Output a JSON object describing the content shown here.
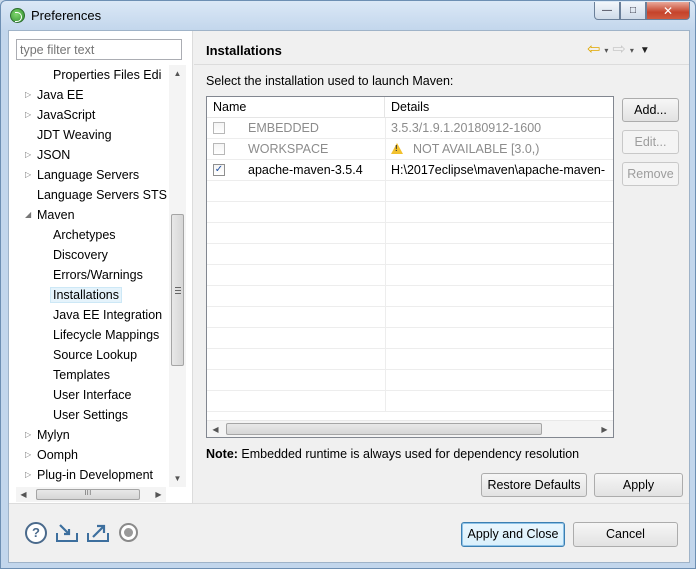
{
  "window": {
    "title": "Preferences",
    "buttons": {
      "minimize": "—",
      "maximize": "□",
      "close": "✕"
    }
  },
  "sidebar": {
    "filter_placeholder": "type filter text",
    "items": [
      {
        "label": "Properties Files Edi",
        "level": 2,
        "twisty": ""
      },
      {
        "label": "Java EE",
        "level": 1,
        "twisty": "▷"
      },
      {
        "label": "JavaScript",
        "level": 1,
        "twisty": "▷"
      },
      {
        "label": "JDT Weaving",
        "level": 1,
        "twisty": ""
      },
      {
        "label": "JSON",
        "level": 1,
        "twisty": "▷"
      },
      {
        "label": "Language Servers",
        "level": 1,
        "twisty": "▷"
      },
      {
        "label": "Language Servers STS",
        "level": 1,
        "twisty": ""
      },
      {
        "label": "Maven",
        "level": 1,
        "twisty": "◢"
      },
      {
        "label": "Archetypes",
        "level": 2,
        "twisty": ""
      },
      {
        "label": "Discovery",
        "level": 2,
        "twisty": ""
      },
      {
        "label": "Errors/Warnings",
        "level": 2,
        "twisty": ""
      },
      {
        "label": "Installations",
        "level": 2,
        "twisty": "",
        "selected": true
      },
      {
        "label": "Java EE Integration",
        "level": 2,
        "twisty": ""
      },
      {
        "label": "Lifecycle Mappings",
        "level": 2,
        "twisty": ""
      },
      {
        "label": "Source Lookup",
        "level": 2,
        "twisty": ""
      },
      {
        "label": "Templates",
        "level": 2,
        "twisty": ""
      },
      {
        "label": "User Interface",
        "level": 2,
        "twisty": ""
      },
      {
        "label": "User Settings",
        "level": 2,
        "twisty": ""
      },
      {
        "label": "Mylyn",
        "level": 1,
        "twisty": "▷"
      },
      {
        "label": "Oomph",
        "level": 1,
        "twisty": "▷"
      },
      {
        "label": "Plug-in Development",
        "level": 1,
        "twisty": "▷"
      }
    ],
    "scroll_up": "▲",
    "scroll_down": "▼",
    "scroll_left": "◀",
    "scroll_right": "▶",
    "hscroll_grip": "III"
  },
  "main": {
    "title": "Installations",
    "nav": {
      "back": "⇦",
      "forward": "⇨",
      "dropdown": "▾",
      "menu": "▼"
    },
    "instruction": "Select the installation used to launch Maven:",
    "table": {
      "columns": [
        "Name",
        "Details"
      ],
      "rows": [
        {
          "checked": false,
          "enabled": false,
          "name": "EMBEDDED",
          "details": "3.5.3/1.9.1.20180912-1600",
          "warning": false
        },
        {
          "checked": false,
          "enabled": false,
          "name": "WORKSPACE",
          "details": "NOT AVAILABLE [3.0,)",
          "warning": true
        },
        {
          "checked": true,
          "enabled": true,
          "name": "apache-maven-3.5.4",
          "details": "H:\\2017eclipse\\maven\\apache-maven-",
          "warning": false
        }
      ],
      "check_mark": "✓"
    },
    "buttons": {
      "add": "Add...",
      "edit": "Edit...",
      "remove": "Remove"
    },
    "note_prefix": "Note:",
    "note_text": " Embedded runtime is always used for dependency resolution",
    "restore_defaults": "Restore Defaults",
    "apply": "Apply"
  },
  "footer": {
    "help_icon": "?",
    "apply_and_close": "Apply and Close",
    "cancel": "Cancel"
  }
}
